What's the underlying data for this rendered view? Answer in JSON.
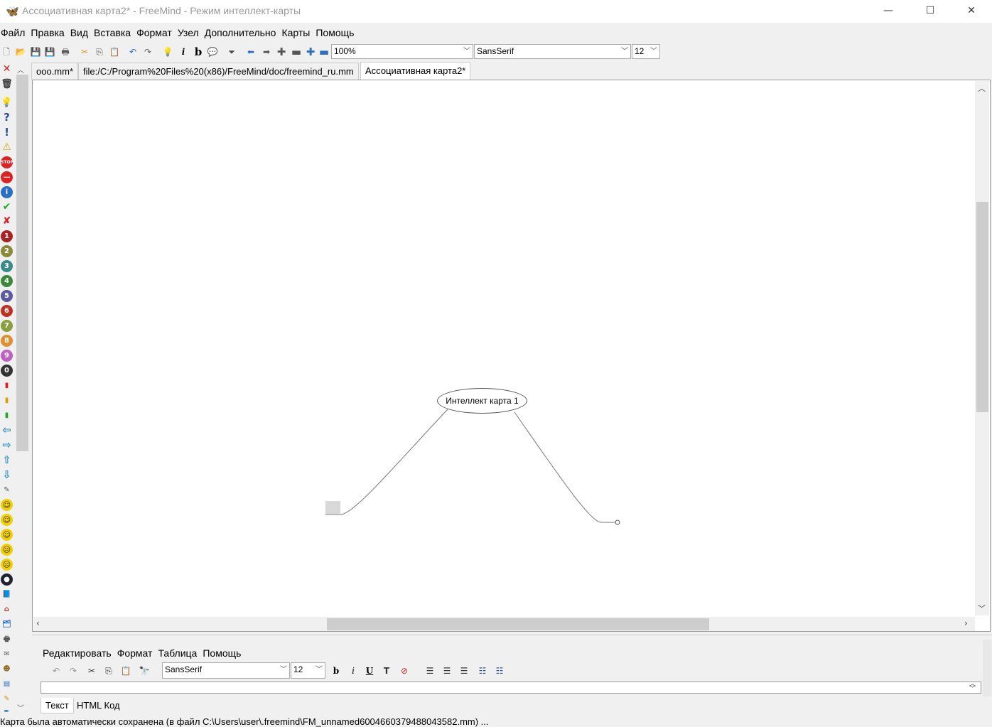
{
  "window": {
    "title": "Ассоциативная карта2* - FreeMind - Режим интеллект-карты",
    "app_icon": "butterfly-icon"
  },
  "menubar": [
    "Файл",
    "Правка",
    "Вид",
    "Вставка",
    "Формат",
    "Узел",
    "Дополнительно",
    "Карты",
    "Помощь"
  ],
  "toolbar": {
    "zoom": "100%",
    "font": "SansSerif",
    "font_size": "12",
    "icons": [
      "new-icon",
      "open-icon",
      "save-icon",
      "save-as-icon",
      "print-icon",
      "cut-icon",
      "copy-icon",
      "paste-icon",
      "undo-icon",
      "redo-icon",
      "idea-icon",
      "italic-icon",
      "bold-icon",
      "cloud-icon",
      "filter-icon",
      "back-icon",
      "forward-icon",
      "zoom-in-icon",
      "zoom-out-icon",
      "add-icon",
      "remove-icon"
    ]
  },
  "tabs": [
    {
      "label": "ooo.mm*",
      "active": false
    },
    {
      "label": "file:/C:/Program%20Files%20(x86)/FreeMind/doc/freemind_ru.mm",
      "active": false
    },
    {
      "label": "Ассоциативная карта2*",
      "active": true
    }
  ],
  "map": {
    "root_node": "Интеллект карта 1"
  },
  "editor": {
    "menu": [
      "Редактировать",
      "Формат",
      "Таблица",
      "Помощь"
    ],
    "font": "SansSerif",
    "font_size": "12",
    "text": "",
    "tabs": [
      {
        "label": "Текст",
        "active": true
      },
      {
        "label": "HTML Код",
        "active": false
      }
    ]
  },
  "status": "Карта была автоматически сохранена (в файл C:\\Users\\user\\.freemind\\FM_unnamed6004660379488043582.mm) ..."
}
